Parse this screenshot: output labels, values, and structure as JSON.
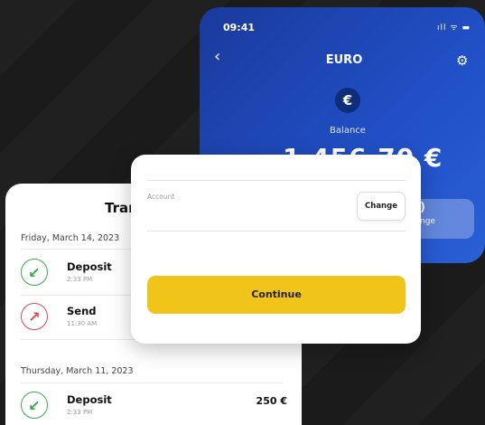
{
  "euro_card": {
    "time": "09:41",
    "status": "ıll ᯤ ▬",
    "back": "‹",
    "title": "EURO",
    "gear": "⚙",
    "currency_symbol": "€",
    "balance_label": "Balance",
    "balance_amount": "1,456.70 €",
    "change_partial": "nge",
    "change_partial_symbol": ")"
  },
  "transactions": {
    "title": "Tran",
    "groups": [
      {
        "date": "Friday, March 14, 2023",
        "items": [
          {
            "name": "Deposit",
            "time": "2:33 PM",
            "icon": "arrow-down-left-icon"
          },
          {
            "name": "Send",
            "time": "11:30 AM",
            "icon": "arrow-up-right-icon"
          }
        ]
      },
      {
        "date": "Thursday, March 11, 2023",
        "items": [
          {
            "name": "Deposit",
            "time": "2:33 PM",
            "amount": "250 €",
            "icon": "arrow-down-left-icon"
          }
        ]
      }
    ]
  },
  "dialog": {
    "account_label": "Account",
    "change_button": "Change",
    "continue_button": "Continue"
  },
  "colors": {
    "background": "#1c1c1c",
    "primary_blue": "#2150c7",
    "continue_yellow": "#f0c419",
    "deposit_green": "#3aa84a",
    "send_red": "#e04848"
  }
}
